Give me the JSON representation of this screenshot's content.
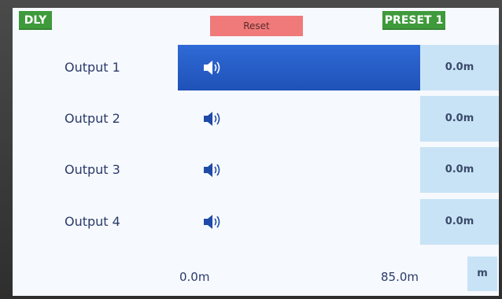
{
  "header": {
    "mode_badge": "DLY",
    "reset_label": "Reset",
    "preset_badge": "PRESET 1"
  },
  "outputs": [
    {
      "label": "Output 1",
      "value": "0.0m",
      "selected": true,
      "icon": "speaker-icon"
    },
    {
      "label": "Output 2",
      "value": "0.0m",
      "selected": false,
      "icon": "speaker-icon"
    },
    {
      "label": "Output 3",
      "value": "0.0m",
      "selected": false,
      "icon": "speaker-icon"
    },
    {
      "label": "Output 4",
      "value": "0.0m",
      "selected": false,
      "icon": "speaker-icon"
    }
  ],
  "scale": {
    "min_label": "0.0m",
    "max_label": "85.0m"
  },
  "unit_button": "m",
  "colors": {
    "badge_green": "#3f9a3b",
    "reset_red": "#f07a7a",
    "selected_blue": "#2f6ad6",
    "value_box": "#c9e3f6"
  }
}
